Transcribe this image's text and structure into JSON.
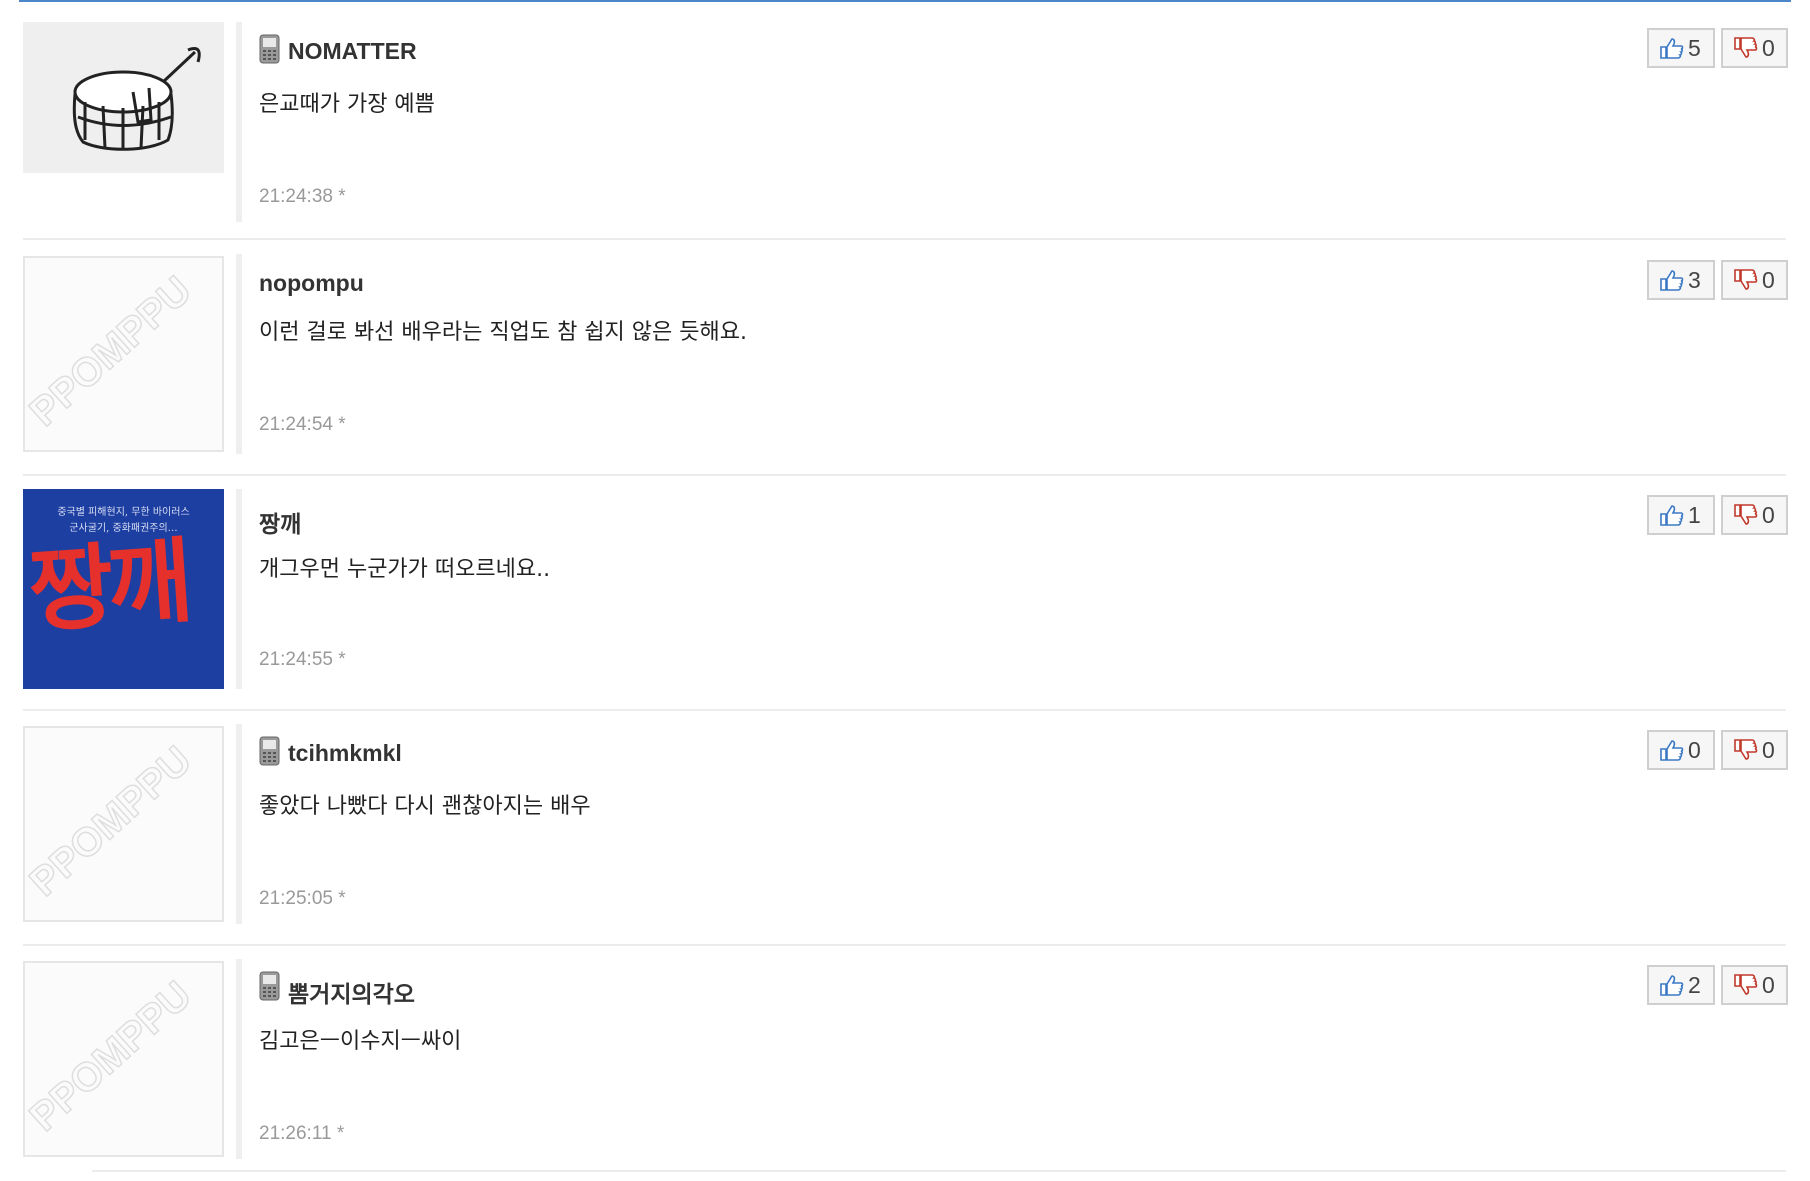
{
  "comments": [
    {
      "avatar": "pail-sketch-avatar",
      "has_phone_icon": true,
      "nickname": "NOMATTER",
      "text": "은교때가 가장 예쁨",
      "time": "21:24:38 *",
      "up": "5",
      "down": "0"
    },
    {
      "avatar": "ppomppu-default-avatar",
      "has_phone_icon": false,
      "nickname": "nopompu",
      "text": "이런 걸로 봐선 배우라는 직업도 참 쉽지 않은 듯해요.",
      "time": "21:24:54 *",
      "up": "3",
      "down": "0"
    },
    {
      "avatar": "book-cover-avatar",
      "has_phone_icon": false,
      "nickname": "짱깨",
      "text": "개그우먼 누군가가 떠오르네요..",
      "time": "21:24:55 *",
      "up": "1",
      "down": "0"
    },
    {
      "avatar": "ppomppu-default-avatar",
      "has_phone_icon": true,
      "nickname": "tcihmkmkl",
      "text": "좋았다 나빴다 다시 괜찮아지는 배우",
      "time": "21:25:05 *",
      "up": "0",
      "down": "0"
    },
    {
      "avatar": "ppomppu-default-avatar",
      "has_phone_icon": true,
      "nickname": "뽐거지의각오",
      "text": "김고은ㅡ이수지ㅡ싸이",
      "time": "21:26:11 *",
      "up": "2",
      "down": "0"
    }
  ],
  "avatar_text": {
    "ppomppu_watermark": "PPOMPPU",
    "book_sub_1": "중국별 피해현지, 무한 바이러스",
    "book_sub_2": "군사굴기, 중화패권주의…",
    "book_title": "짱깨"
  },
  "colors": {
    "frame_border": "#4a86c8",
    "book_bg": "#1e3fa2",
    "book_title": "#e5302b",
    "thumb_up": "#3b78c4",
    "thumb_down": "#c0392b"
  }
}
